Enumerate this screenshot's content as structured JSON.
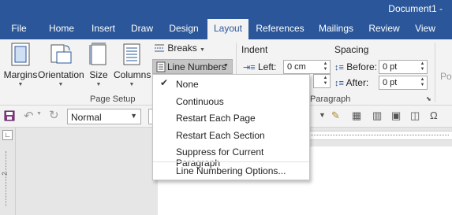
{
  "window": {
    "title": "Document1 -"
  },
  "tabs": [
    {
      "label": "File"
    },
    {
      "label": "Home"
    },
    {
      "label": "Insert"
    },
    {
      "label": "Draw"
    },
    {
      "label": "Design"
    },
    {
      "label": "Layout"
    },
    {
      "label": "References"
    },
    {
      "label": "Mailings"
    },
    {
      "label": "Review"
    },
    {
      "label": "View"
    }
  ],
  "ribbon": {
    "page_setup": {
      "label": "Page Setup",
      "margins": "Margins",
      "orientation": "Orientation",
      "size": "Size",
      "columns": "Columns",
      "breaks": "Breaks",
      "line_numbers": "Line Numbers"
    },
    "paragraph": {
      "label": "Paragraph",
      "indent_label": "Indent",
      "left_label": "Left:",
      "left_value": "0 cm",
      "spacing_label": "Spacing",
      "before_label": "Before:",
      "before_value": "0 pt",
      "after_label": "After:",
      "after_value": "0 pt"
    },
    "right_partial": "Po"
  },
  "format_bar": {
    "style_value": "Normal"
  },
  "line_numbers_menu": {
    "items": [
      {
        "label": "None",
        "checked": true
      },
      {
        "label": "Continuous",
        "checked": false
      },
      {
        "label": "Restart Each Page",
        "checked": false
      },
      {
        "label": "Restart Each Section",
        "checked": false
      },
      {
        "label": "Suppress for Current Paragraph",
        "checked": false
      },
      {
        "label": "Line Numbering Options...",
        "checked": false
      }
    ]
  },
  "ruler": {
    "vertical_mark": "2"
  },
  "colors": {
    "accent": "#2b579a",
    "ribbon_bg": "#f3f3f3",
    "highlight": "#c5c5c5"
  },
  "icons": [
    "margins-icon",
    "orientation-icon",
    "size-icon",
    "columns-icon",
    "breaks-icon",
    "line-numbers-icon",
    "save-icon",
    "undo-icon",
    "redo-icon"
  ]
}
